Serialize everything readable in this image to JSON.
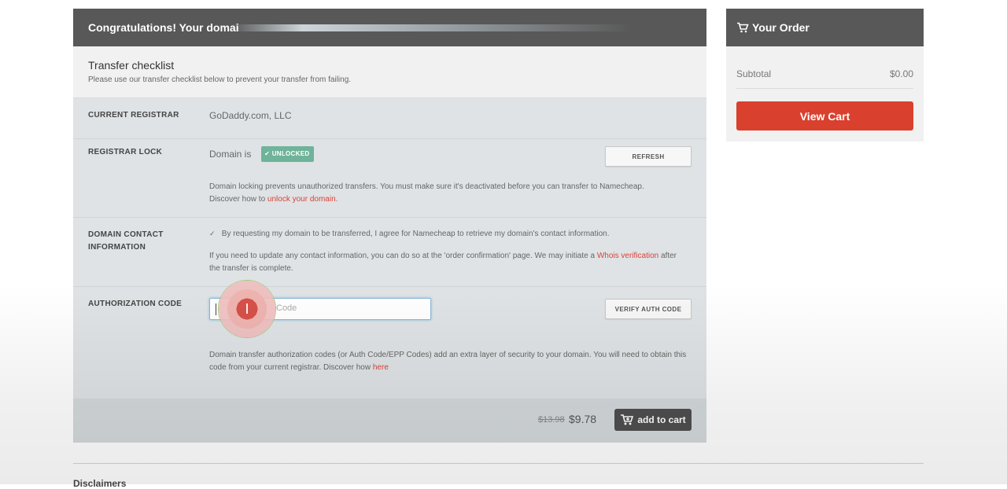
{
  "header": {
    "title": "Congratulations! Your domai"
  },
  "checklist": {
    "title": "Transfer checklist",
    "subtitle": "Please use our transfer checklist below to prevent your transfer from failing."
  },
  "current_registrar": {
    "label": "CURRENT REGISTRAR",
    "value": "GoDaddy.com, LLC"
  },
  "registrar_lock": {
    "label": "REGISTRAR LOCK",
    "domain_is": "Domain is",
    "status": "UNLOCKED",
    "refresh_label": "REFRESH",
    "description": "Domain locking prevents unauthorized transfers. You must make sure it's deactivated before you can transfer to Namecheap.",
    "discover_text": "Discover how to",
    "link_text": "unlock your domain",
    "link_suffix": "."
  },
  "domain_contact": {
    "label": "DOMAIN CONTACT INFORMATION",
    "checked": true,
    "consent_text": "By requesting my domain to be transferred, I agree for Namecheap to retrieve my domain's contact information.",
    "info_text": "If you need to update any contact information, you can do so at the 'order confirmation' page. We may initiate a",
    "link_text": "Whois verification",
    "info_suffix": "after the transfer is complete."
  },
  "authorization": {
    "label": "AUTHORIZATION CODE",
    "input_placeholder": "Code",
    "verify_label": "VERIFY AUTH CODE",
    "description": "Domain transfer authorization codes (or Auth Code/EPP Codes) add an extra layer of security to your domain. You will need to obtain this code from your current registrar. Discover how",
    "link_text": "here"
  },
  "pricing": {
    "old_price": "$13.98",
    "new_price": "$9.78",
    "add_to_cart_label": "add to cart"
  },
  "order": {
    "title": "Your Order",
    "subtotal_label": "Subtotal",
    "subtotal_value": "$0.00",
    "view_cart_label": "View Cart"
  },
  "footer": {
    "disclaimer_label": "Disclaimers"
  },
  "icons": {
    "cart": "cart-icon",
    "check": "check-icon",
    "checkbox": "checkbox-icon",
    "text_cursor": "text-cursor-icon"
  },
  "colors": {
    "header_bg": "#585858",
    "accent_red": "#d9402e",
    "link_red": "#d8423a",
    "unlocked_green": "#6fb39a",
    "cursor_ring": "#4fd534"
  }
}
